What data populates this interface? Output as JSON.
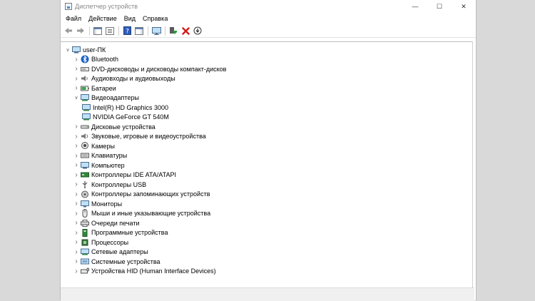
{
  "window": {
    "title": "Диспетчер устройств",
    "min": "—",
    "max": "☐",
    "close": "✕"
  },
  "menu": [
    "Файл",
    "Действие",
    "Вид",
    "Справка"
  ],
  "tree": {
    "root": "user-ПК",
    "items": [
      {
        "label": "Bluetooth",
        "icon": "bluetooth-icon"
      },
      {
        "label": "DVD-дисководы и дисководы компакт-дисков",
        "icon": "dvd-drive-icon"
      },
      {
        "label": "Аудиовходы и аудиовыходы",
        "icon": "audio-icon"
      },
      {
        "label": "Батареи",
        "icon": "battery-icon"
      },
      {
        "label": "Видеоадаптеры",
        "icon": "display-adapter-icon",
        "expanded": true,
        "children": [
          {
            "label": "Intel(R) HD Graphics 3000",
            "icon": "display-adapter-icon"
          },
          {
            "label": "NVIDIA GeForce GT 540M",
            "icon": "display-adapter-icon"
          }
        ]
      },
      {
        "label": "Дисковые устройства",
        "icon": "disk-drive-icon"
      },
      {
        "label": "Звуковые, игровые и видеоустройства",
        "icon": "speaker-icon"
      },
      {
        "label": "Камеры",
        "icon": "camera-icon"
      },
      {
        "label": "Клавиатуры",
        "icon": "keyboard-icon"
      },
      {
        "label": "Компьютер",
        "icon": "computer-icon"
      },
      {
        "label": "Контроллеры IDE ATA/ATAPI",
        "icon": "ide-controller-icon"
      },
      {
        "label": "Контроллеры USB",
        "icon": "usb-icon"
      },
      {
        "label": "Контроллеры запоминающих устройств",
        "icon": "storage-controller-icon"
      },
      {
        "label": "Мониторы",
        "icon": "monitor-icon"
      },
      {
        "label": "Мыши и иные указывающие устройства",
        "icon": "mouse-icon"
      },
      {
        "label": "Очереди печати",
        "icon": "printer-icon"
      },
      {
        "label": "Программные устройства",
        "icon": "software-device-icon"
      },
      {
        "label": "Процессоры",
        "icon": "processor-icon"
      },
      {
        "label": "Сетевые адаптеры",
        "icon": "network-adapter-icon"
      },
      {
        "label": "Системные устройства",
        "icon": "system-device-icon"
      },
      {
        "label": "Устройства HID (Human Interface Devices)",
        "icon": "hid-icon"
      }
    ]
  }
}
